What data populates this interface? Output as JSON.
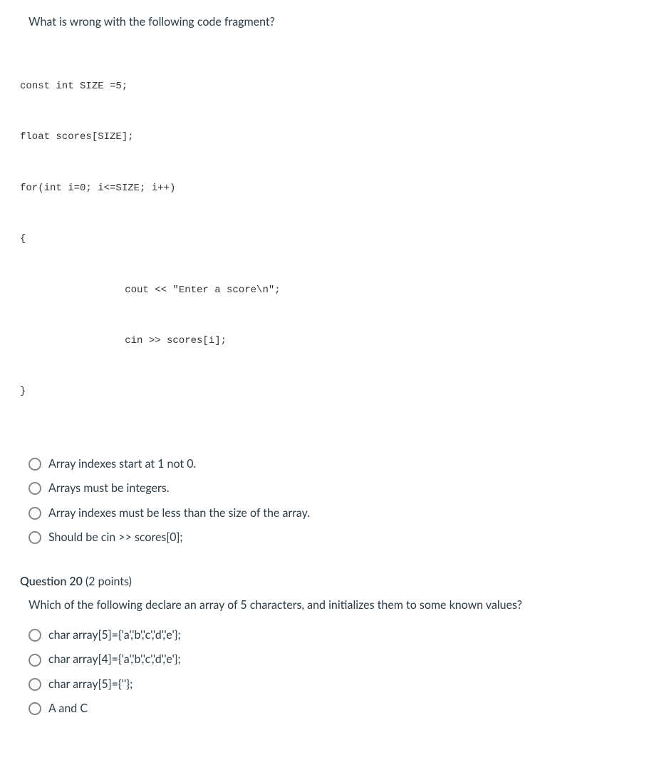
{
  "questions": [
    {
      "prompt": "What is wrong with the following code fragment?",
      "code": [
        "const int SIZE =5;",
        "float scores[SIZE];",
        "for(int i=0; i<=SIZE; i++)",
        "{",
        "        cout << \"Enter a score\\n\";",
        "        cin >> scores[i];",
        "}"
      ],
      "options": [
        "Array indexes start at 1 not 0.",
        "Arrays must be integers.",
        "Array indexes must be less than the size of the array.",
        "Should be cin >> scores[0];"
      ]
    },
    {
      "header": "Question 20",
      "points": "(2 points)",
      "prompt": "Which of the following declare an array of 5 characters, and initializes them to some known values?",
      "options": [
        "char array[5]={'a','b','c','d','e'};",
        "char array[4]={'a','b','c','d','e'};",
        "char array[5]={''};",
        "A and C"
      ]
    }
  ]
}
